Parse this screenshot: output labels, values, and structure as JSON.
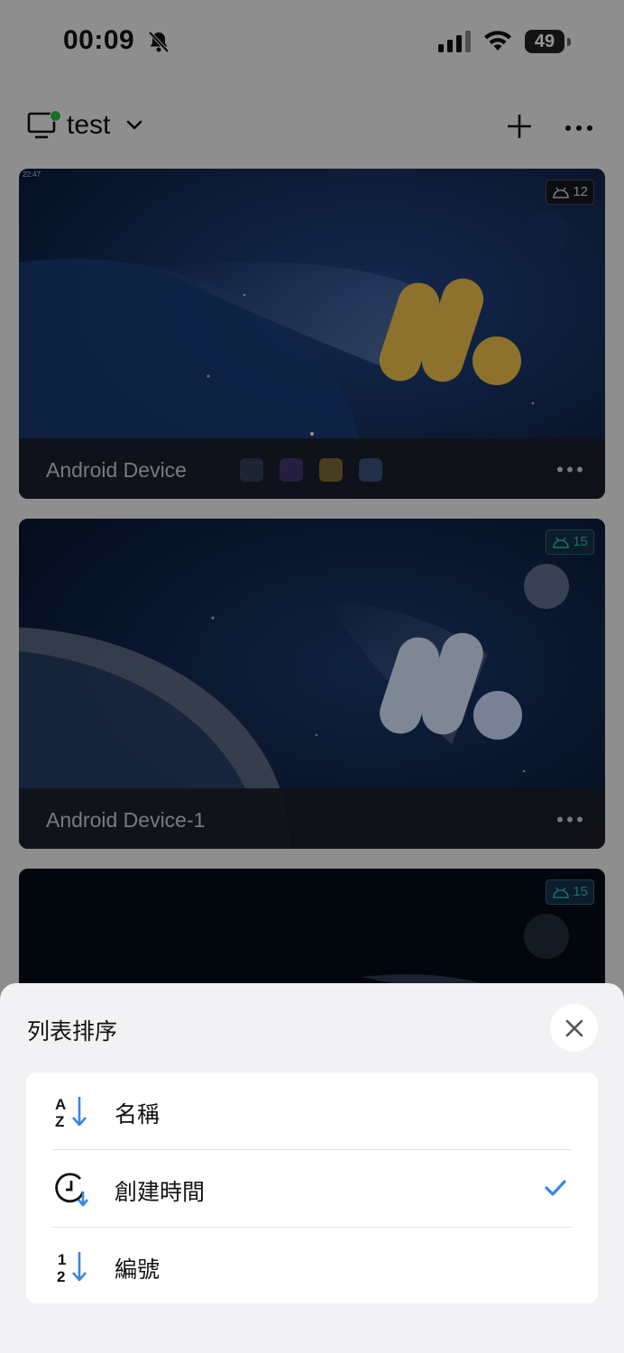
{
  "status_bar": {
    "time": "00:09",
    "battery": "49",
    "icons": [
      "bell-slash-icon",
      "cellular-signal-icon",
      "wifi-icon",
      "battery-icon"
    ]
  },
  "header": {
    "group_name": "test",
    "icons": [
      "monitor-icon",
      "chevron-down-icon",
      "plus-icon",
      "more-icon"
    ],
    "online_color": "#29c23f"
  },
  "devices": [
    {
      "name": "Android Device",
      "android_version": "12",
      "mini_clock": "22:47"
    },
    {
      "name": "Android Device-1",
      "android_version": "15"
    },
    {
      "android_version": "15"
    }
  ],
  "sort_sheet": {
    "title": "列表排序",
    "options": [
      {
        "label": "名稱",
        "icon": "sort-alpha-icon",
        "selected": false
      },
      {
        "label": "創建時間",
        "icon": "sort-clock-icon",
        "selected": true
      },
      {
        "label": "編號",
        "icon": "sort-numeric-icon",
        "selected": false
      }
    ],
    "accent": "#3a86e8"
  }
}
